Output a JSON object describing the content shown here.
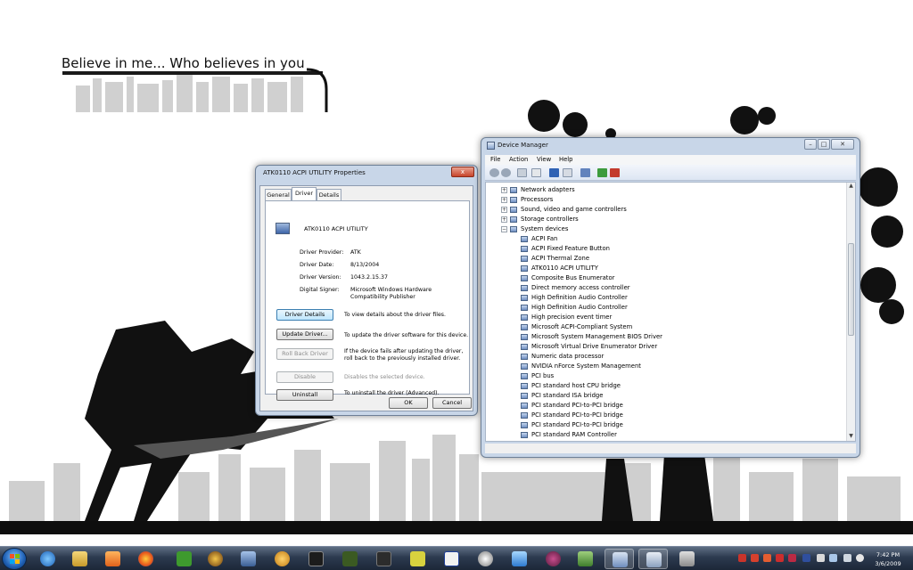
{
  "wallpaper": {
    "title": "Believe in me... Who believes in you"
  },
  "properties": {
    "title": "ATK0110 ACPI UTILITY Properties",
    "close_label": "x",
    "tabs": [
      "General",
      "Driver",
      "Details"
    ],
    "active_tab": "Driver",
    "device_name": "ATK0110 ACPI UTILITY",
    "fields": [
      {
        "label": "Driver Provider:",
        "value": "ATK"
      },
      {
        "label": "Driver Date:",
        "value": "8/13/2004"
      },
      {
        "label": "Driver Version:",
        "value": "1043.2.15.37"
      },
      {
        "label": "Digital Signer:",
        "value": "Microsoft Windows Hardware Compatibility Publisher"
      }
    ],
    "actions": [
      {
        "button": "Driver Details",
        "description": "To view details about the driver files.",
        "enabled": true
      },
      {
        "button": "Update Driver...",
        "description": "To update the driver software for this device.",
        "enabled": true
      },
      {
        "button": "Roll Back Driver",
        "description": "If the device fails after updating the driver, roll back to the previously installed driver.",
        "enabled": false
      },
      {
        "button": "Disable",
        "description": "Disables the selected device.",
        "enabled": false
      },
      {
        "button": "Uninstall",
        "description": "To uninstall the driver (Advanced).",
        "enabled": true
      }
    ],
    "ok_label": "OK",
    "cancel_label": "Cancel"
  },
  "device_manager": {
    "title": "Device Manager",
    "menu": [
      "File",
      "Action",
      "View",
      "Help"
    ],
    "toolbar_icons": [
      "back-icon",
      "forward-icon",
      "properties-icon",
      "show-hide-icon",
      "help-icon",
      "view-icon",
      "scan-hardware-icon",
      "update-driver-icon",
      "uninstall-icon"
    ],
    "categories": [
      {
        "label": "Network adapters",
        "expanded": false
      },
      {
        "label": "Processors",
        "expanded": false
      },
      {
        "label": "Sound, video and game controllers",
        "expanded": false
      },
      {
        "label": "Storage controllers",
        "expanded": false
      },
      {
        "label": "System devices",
        "expanded": true
      }
    ],
    "system_devices": [
      "ACPI Fan",
      "ACPI Fixed Feature Button",
      "ACPI Thermal Zone",
      "ATK0110 ACPI UTILITY",
      "Composite Bus Enumerator",
      "Direct memory access controller",
      "High Definition Audio Controller",
      "High Definition Audio Controller",
      "High precision event timer",
      "Microsoft ACPI-Compliant System",
      "Microsoft System Management BIOS Driver",
      "Microsoft Virtual Drive Enumerator Driver",
      "Numeric data processor",
      "NVIDIA nForce System Management",
      "PCI bus",
      "PCI standard host CPU bridge",
      "PCI standard ISA bridge",
      "PCI standard PCI-to-PCI bridge",
      "PCI standard PCI-to-PCI bridge",
      "PCI standard PCI-to-PCI bridge",
      "PCI standard RAM Controller"
    ]
  },
  "taskbar": {
    "pinned_icons": [
      "internet-explorer-icon",
      "windows-explorer-icon",
      "media-player-icon",
      "firefox-icon",
      "utorrent-icon",
      "world-of-warcraft-icon",
      "network-icon",
      "messenger-icon",
      "steam-icon",
      "game-icon",
      "game-icon",
      "game-icon",
      "media-icon",
      "settings-icon",
      "itunes-icon",
      "app-icon",
      "app-icon",
      "device-manager-icon",
      "window-icon",
      "printer-icon"
    ],
    "tray_icons": [
      "tray-icon",
      "tray-icon",
      "tray-icon",
      "tray-icon",
      "tray-icon",
      "tray-icon",
      "tray-icon",
      "volume-icon"
    ],
    "time": "7:42 PM",
    "date": "3/6/2009"
  },
  "colors": {
    "selection": "#cce8ff",
    "taskbar": "#2c3a4f",
    "window_frame": "#c8d6e8"
  }
}
